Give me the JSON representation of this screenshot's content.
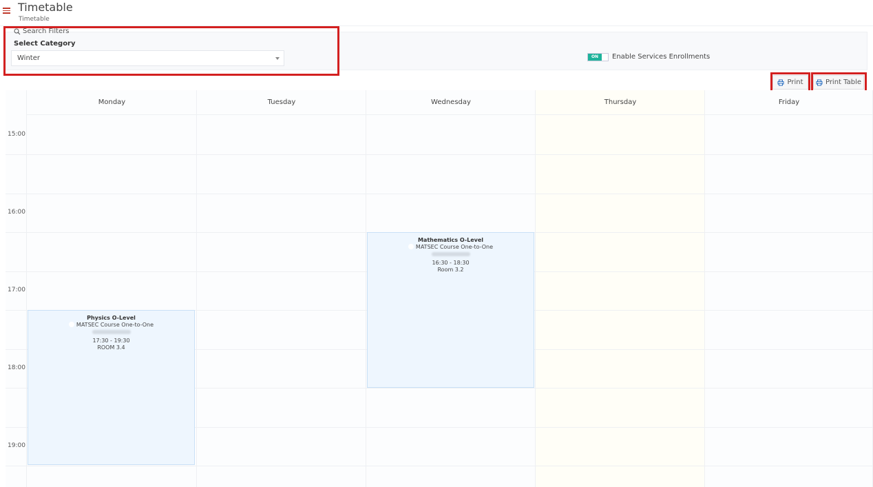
{
  "header": {
    "title": "Timetable",
    "subtitle": "Timetable"
  },
  "filters": {
    "heading": "Search Filters",
    "select_label": "Select Category",
    "selected_value": "Winter",
    "toggle_state": "ON",
    "toggle_label": "Enable Services Enrollments"
  },
  "toolbar": {
    "print_label": "Print",
    "print_table_label": "Print Table"
  },
  "days": [
    "Monday",
    "Tuesday",
    "Wednesday",
    "Thursday",
    "Friday"
  ],
  "times": [
    "15:00",
    "16:00",
    "17:00",
    "18:00",
    "19:00"
  ],
  "events": [
    {
      "day": "Monday",
      "title": "Physics O-Level",
      "course": "MATSEC Course One-to-One",
      "time": "17:30 - 19:30",
      "room": "ROOM 3.4"
    },
    {
      "day": "Wednesday",
      "title": "Mathematics O-Level",
      "course": "MATSEC Course One-to-One",
      "time": "16:30 - 18:30",
      "room": "Room 3.2"
    }
  ],
  "colors": {
    "accent_menu": "#c0392b",
    "toggle_on": "#1fb39b",
    "highlight": "#d32020",
    "event_bg": "#eef6fe",
    "print_icon": "#2a6fc1"
  }
}
